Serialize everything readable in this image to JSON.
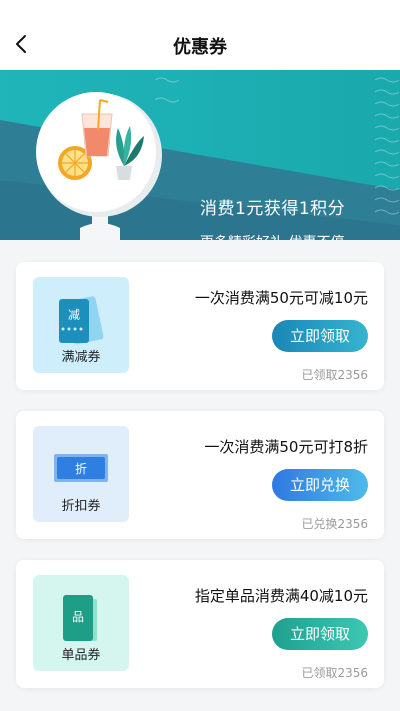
{
  "header": {
    "title": "优惠券"
  },
  "banner": {
    "line1": "消费1元获得1积分",
    "line2": "更多精彩好礼 优惠不停"
  },
  "coupons": [
    {
      "tile_label": "满减券",
      "tile_icon_text": "减",
      "description": "一次消费满50元可减10元",
      "button_label": "立即领取",
      "count_text": "已领取2356",
      "colors": {
        "tile_bg": "#cfeefc",
        "icon": "#1c8fbd",
        "btn_from": "#1a87b6",
        "btn_to": "#35b4d0"
      }
    },
    {
      "tile_label": "折扣券",
      "tile_icon_text": "折",
      "description": "一次消费满50元可打8折",
      "button_label": "立即兑换",
      "count_text": "已兑换2356",
      "colors": {
        "tile_bg": "#e0eefc",
        "icon": "#2f7fe0",
        "btn_from": "#2f79e2",
        "btn_to": "#4dbbe8"
      }
    },
    {
      "tile_label": "单品券",
      "tile_icon_text": "品",
      "description": "指定单品消费满40减10元",
      "button_label": "立即领取",
      "count_text": "已领取2356",
      "colors": {
        "tile_bg": "#d4f6ef",
        "icon": "#1f9e87",
        "btn_from": "#1fa08e",
        "btn_to": "#3cc8b2"
      }
    }
  ]
}
